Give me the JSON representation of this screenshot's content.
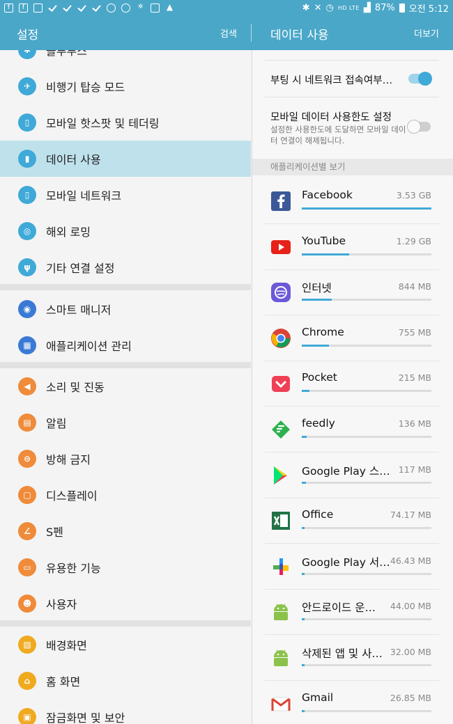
{
  "status_bar": {
    "battery": "87%",
    "time": "오전 5:12",
    "network_small": "HD LTE"
  },
  "header": {
    "left_title": "설정",
    "search_label": "검색",
    "right_title": "데이터 사용",
    "more_label": "더보기"
  },
  "sidebar": {
    "items": [
      {
        "label": "블루투스",
        "icon": "bluetooth-icon"
      },
      {
        "label": "비행기 탑승 모드",
        "icon": "airplane-icon"
      },
      {
        "label": "모바일 핫스팟 및 테더링",
        "icon": "hotspot-icon"
      },
      {
        "label": "데이터 사용",
        "icon": "data-usage-icon"
      },
      {
        "label": "모바일 네트워크",
        "icon": "mobile-network-icon"
      },
      {
        "label": "해외 로밍",
        "icon": "roaming-icon"
      },
      {
        "label": "기타 연결 설정",
        "icon": "more-connections-icon"
      },
      {
        "label": "스마트 매니저",
        "icon": "smart-manager-icon"
      },
      {
        "label": "애플리케이션 관리",
        "icon": "apps-icon"
      },
      {
        "label": "소리 및 진동",
        "icon": "sound-icon"
      },
      {
        "label": "알림",
        "icon": "notification-icon"
      },
      {
        "label": "방해 금지",
        "icon": "do-not-disturb-icon"
      },
      {
        "label": "디스플레이",
        "icon": "display-icon"
      },
      {
        "label": "S펜",
        "icon": "s-pen-icon"
      },
      {
        "label": "유용한 기능",
        "icon": "useful-features-icon"
      },
      {
        "label": "사용자",
        "icon": "users-icon"
      },
      {
        "label": "배경화면",
        "icon": "wallpaper-icon"
      },
      {
        "label": "홈 화면",
        "icon": "home-screen-icon"
      },
      {
        "label": "잠금화면 및 보안",
        "icon": "lock-security-icon"
      }
    ]
  },
  "data_usage": {
    "boot_network_label": "부팅 시 네트워크 접속여부…",
    "boot_network_on": true,
    "limit_title": "모바일 데이터 사용한도 설정",
    "limit_desc": "설정한 사용한도에 도달하면 모바일 데이터 연결이 해제됩니다.",
    "limit_on": false,
    "section_header": "애플리케이션별 보기",
    "apps": [
      {
        "name": "Facebook",
        "size": "3.53 GB",
        "usage": 1.0
      },
      {
        "name": "YouTube",
        "size": "1.29 GB",
        "usage": 0.365
      },
      {
        "name": "인터넷",
        "size": "844 MB",
        "usage": 0.233
      },
      {
        "name": "Chrome",
        "size": "755 MB",
        "usage": 0.209
      },
      {
        "name": "Pocket",
        "size": "215 MB",
        "usage": 0.059
      },
      {
        "name": "feedly",
        "size": "136 MB",
        "usage": 0.038
      },
      {
        "name": "Google Play 스…",
        "size": "117 MB",
        "usage": 0.032
      },
      {
        "name": "Office",
        "size": "74.17 MB",
        "usage": 0.021
      },
      {
        "name": "Google Play 서…",
        "size": "46.43 MB",
        "usage": 0.013
      },
      {
        "name": "안드로이드 운…",
        "size": "44.00 MB",
        "usage": 0.012
      },
      {
        "name": "삭제된 앱 및 사…",
        "size": "32.00 MB",
        "usage": 0.009
      },
      {
        "name": "Gmail",
        "size": "26.85 MB",
        "usage": 0.007
      }
    ]
  }
}
